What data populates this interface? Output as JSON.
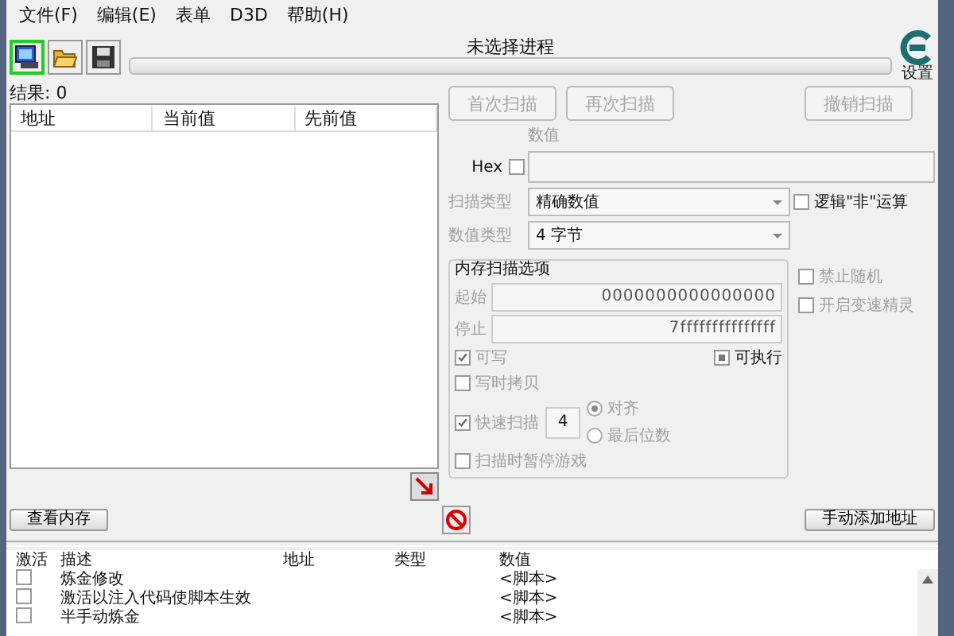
{
  "menu": [
    "文件(F)",
    "编辑(E)",
    "表单",
    "D3D",
    "帮助(H)"
  ],
  "toolbar": {
    "buttons": [
      {
        "kind": "process",
        "selected": true
      },
      {
        "kind": "open",
        "selected": false
      },
      {
        "kind": "save",
        "selected": false
      }
    ],
    "process_title": "未选择进程",
    "progress": {
      "level": 0
    },
    "settings_label": "设置"
  },
  "results_label": "结果: 0",
  "found_list": {
    "columns": [
      "地址",
      "当前值",
      "先前值"
    ]
  },
  "scan_buttons": [
    {
      "label": "首次扫描",
      "disabled": true
    },
    {
      "label": "再次扫描",
      "disabled": true
    },
    {
      "label": "撤销扫描",
      "disabled": true
    }
  ],
  "value": {
    "label": "数值",
    "hex_label": "Hex",
    "hex_checked": false
  },
  "scan_type": {
    "label": "扫描类型",
    "value": "精确数值",
    "disabled": true
  },
  "value_type": {
    "label": "数值类型",
    "value": "4 字节",
    "disabled": true
  },
  "not_operation": {
    "label": "逻辑\"非\"运算",
    "checked": false
  },
  "memory_options": {
    "title": "内存扫描选项",
    "disabled": true,
    "start_label": "起始",
    "start": "0000000000000000",
    "stop_label": "停止",
    "stop": "7fffffffffffffff",
    "writable": {
      "label": "可写",
      "checked": true
    },
    "executable": {
      "label": "可执行",
      "indeterminate": true
    },
    "copy_on_write": {
      "label": "写时拷贝",
      "checked": false
    },
    "fast_scan": {
      "label": "快速扫描",
      "checked": true,
      "digits": "4"
    },
    "alignment": [
      {
        "label": "对齐",
        "selected": true
      },
      {
        "label": "最后位数",
        "selected": false
      }
    ],
    "pause_game": {
      "label": "扫描时暂停游戏",
      "checked": false
    }
  },
  "side_options": [
    {
      "label": "禁止随机",
      "checked": false
    },
    {
      "label": "开启变速精灵",
      "checked": false
    }
  ],
  "view_memory": "查看内存",
  "add_address": "手动添加地址",
  "cheat_table": {
    "columns": [
      "激活",
      "描述",
      "地址",
      "类型",
      "数值"
    ],
    "rows": [
      {
        "active": false,
        "description": "炼金修改",
        "value": "<脚本>"
      },
      {
        "active": false,
        "description": "激活以注入代码使脚本生效",
        "value": "<脚本>"
      },
      {
        "active": false,
        "description": "半手动炼金",
        "value": "<脚本>"
      }
    ]
  }
}
